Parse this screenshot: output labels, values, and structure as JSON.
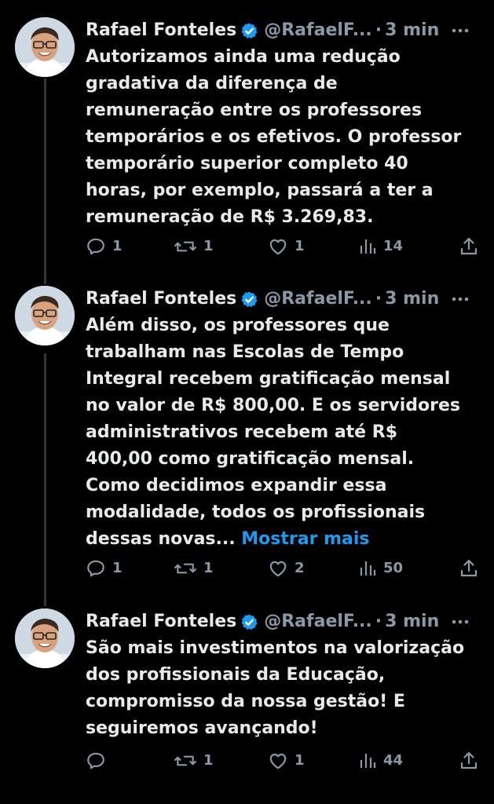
{
  "colors": {
    "background": "#000000",
    "text": "#e7e9ea",
    "muted": "#8b98a5",
    "link": "#1d9bf0",
    "verified": "#1d9bf0",
    "thread_line": "#333639"
  },
  "tweets": [
    {
      "author": {
        "name": "Rafael Fonteles",
        "handle": "@RafaelF...",
        "separator": "·",
        "time": "3 min"
      },
      "text_lines": [
        "Autorizamos ainda uma redução",
        "gradativa da diferença de",
        "remuneração entre os professores",
        "temporários e os efetivos. O professor",
        "temporário superior completo 40",
        "horas, por exemplo, passará a ter a",
        "remuneração de R$ 3.269,83."
      ],
      "actions": {
        "replies": "1",
        "retweets": "1",
        "likes": "1",
        "views": "14"
      }
    },
    {
      "author": {
        "name": "Rafael Fonteles",
        "handle": "@RafaelF...",
        "separator": "·",
        "time": "3 min"
      },
      "text_lines": [
        "Além disso, os professores que",
        "trabalham nas Escolas de Tempo",
        "Integral recebem gratificação mensal",
        "no valor de R$ 800,00. E os servidores",
        "administrativos recebem até R$",
        "400,00 como gratificação mensal.",
        "Como decidimos expandir essa",
        "modalidade, todos os profissionais",
        "dessas novas..."
      ],
      "show_more": "Mostrar mais",
      "actions": {
        "replies": "1",
        "retweets": "1",
        "likes": "2",
        "views": "50"
      }
    },
    {
      "author": {
        "name": "Rafael Fonteles",
        "handle": "@RafaelF...",
        "separator": "·",
        "time": "3 min"
      },
      "text_lines": [
        "São mais investimentos na valorização",
        "dos profissionais da Educação,",
        "compromisso da nossa gestão! E",
        "seguiremos avançando!"
      ],
      "actions": {
        "replies": "",
        "retweets": "1",
        "likes": "1",
        "views": "44"
      }
    }
  ]
}
